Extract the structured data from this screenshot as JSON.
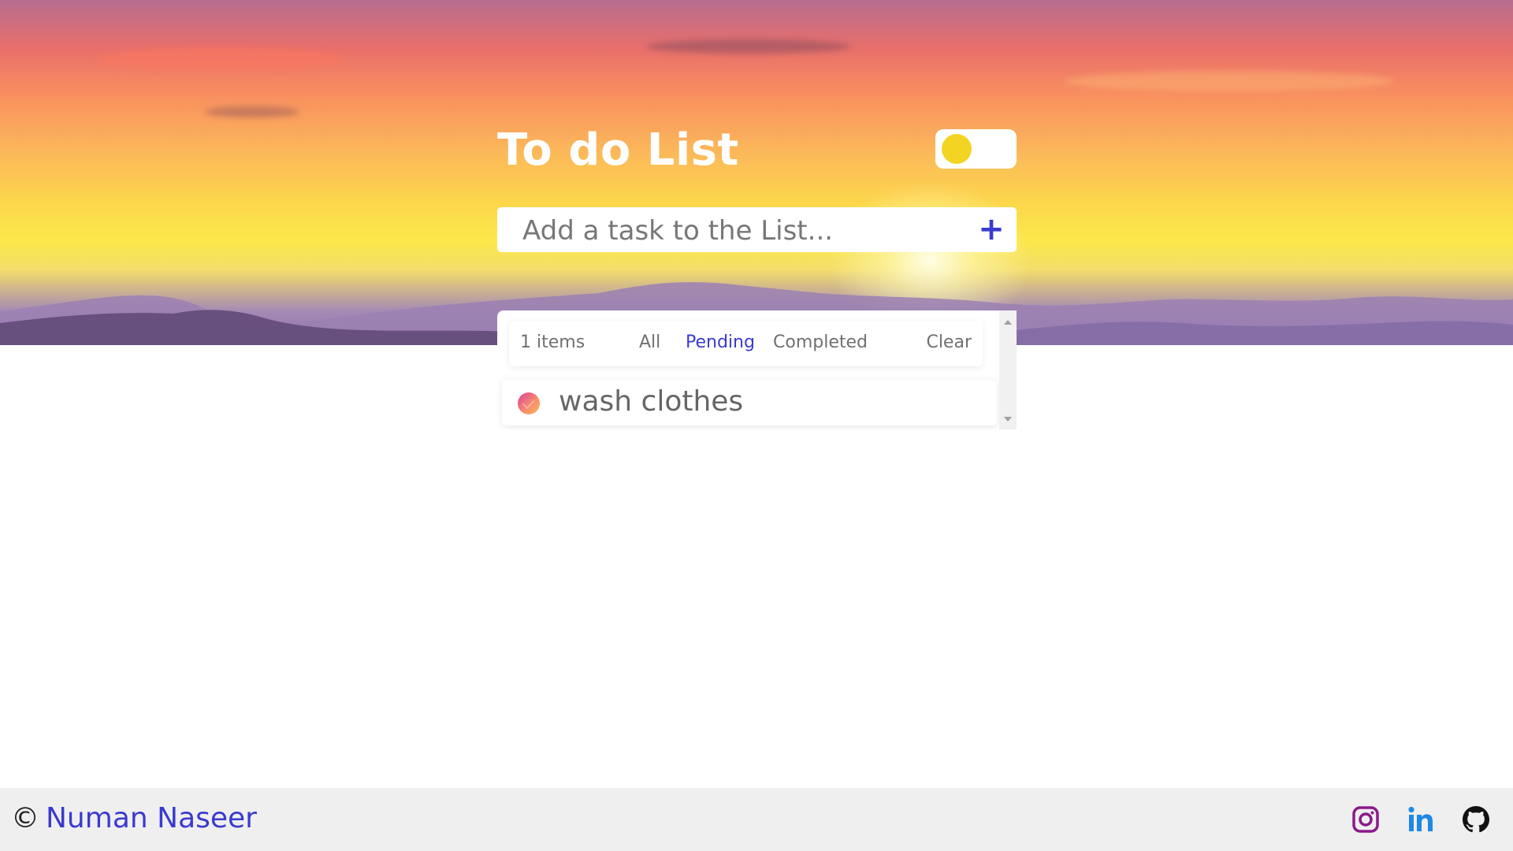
{
  "app": {
    "title": "To do List",
    "theme_toggle": {
      "state": "light",
      "knob_color": "#f4d423"
    }
  },
  "task_input": {
    "placeholder": "Add a task to the List...",
    "value": "",
    "add_icon": "plus-icon",
    "accent": "#3a3ad0"
  },
  "list": {
    "count_label": "1 items",
    "filters": {
      "all": "All",
      "pending": "Pending",
      "completed": "Completed",
      "active": "Pending"
    },
    "clear_label": "Clear",
    "items": [
      {
        "text": "wash clothes",
        "completed": false
      }
    ]
  },
  "footer": {
    "copyright_symbol": "©",
    "author": "Numan Naseer",
    "social": [
      {
        "name": "instagram-icon",
        "color": "#8a1a8a"
      },
      {
        "name": "linkedin-icon",
        "color": "#1e88e5"
      },
      {
        "name": "github-icon",
        "color": "#111111"
      }
    ]
  }
}
